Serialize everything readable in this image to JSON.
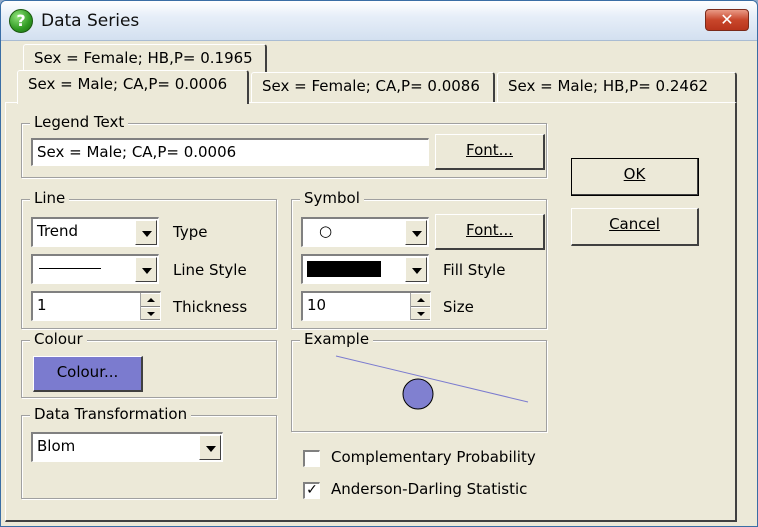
{
  "window": {
    "title": "Data Series",
    "close_label": "✕"
  },
  "tabs": {
    "row1": [
      {
        "label": "Sex = Female; HB,P= 0.1965"
      }
    ],
    "row2": [
      {
        "label": "Sex = Male; CA,P= 0.0006",
        "active": true
      },
      {
        "label": "Sex = Female; CA,P= 0.0086"
      },
      {
        "label": "Sex = Male; HB,P= 0.2462"
      }
    ]
  },
  "legend": {
    "group_label": "Legend Text",
    "text_value": "Sex = Male; CA,P= 0.0006",
    "font_button": "Font..."
  },
  "line": {
    "group_label": "Line",
    "type_value": "Trend",
    "type_label": "Type",
    "style_label": "Line Style",
    "thickness_value": "1",
    "thickness_label": "Thickness"
  },
  "symbol": {
    "group_label": "Symbol",
    "symbol_value": "○",
    "font_button": "Font...",
    "fill_label": "Fill Style",
    "fill_color": "#000000",
    "size_value": "10",
    "size_label": "Size"
  },
  "colour": {
    "group_label": "Colour",
    "button_label": "Colour...",
    "color": "#7b7bcf"
  },
  "example": {
    "group_label": "Example",
    "line_color": "#7b7bcf",
    "symbol_fill": "#8080d0"
  },
  "transformation": {
    "group_label": "Data Transformation",
    "value": "Blom"
  },
  "options": {
    "complementary_label": "Complementary Probability",
    "complementary_checked": false,
    "anderson_label": "Anderson-Darling Statistic",
    "anderson_checked": true
  },
  "buttons": {
    "ok": "OK",
    "cancel": "Cancel"
  }
}
